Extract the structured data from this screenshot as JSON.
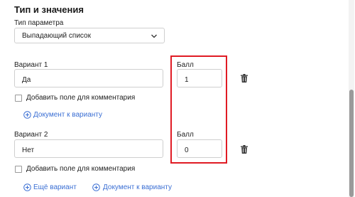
{
  "section": {
    "title": "Тип и значения"
  },
  "param_type": {
    "label": "Тип параметра",
    "value": "Выпадающий список"
  },
  "variants": [
    {
      "label": "Вариант 1",
      "value": "Да",
      "score_label": "Балл",
      "score_value": "1",
      "comment_label": "Добавить поле для комментария",
      "doc_link": "Документ к варианту"
    },
    {
      "label": "Вариант 2",
      "value": "Нет",
      "score_label": "Балл",
      "score_value": "0",
      "comment_label": "Добавить поле для комментария"
    }
  ],
  "footer": {
    "add_variant": "Ещё вариант",
    "doc_link": "Документ к варианту"
  },
  "colors": {
    "accent": "#3b6fd4",
    "highlight": "#e01b24"
  }
}
